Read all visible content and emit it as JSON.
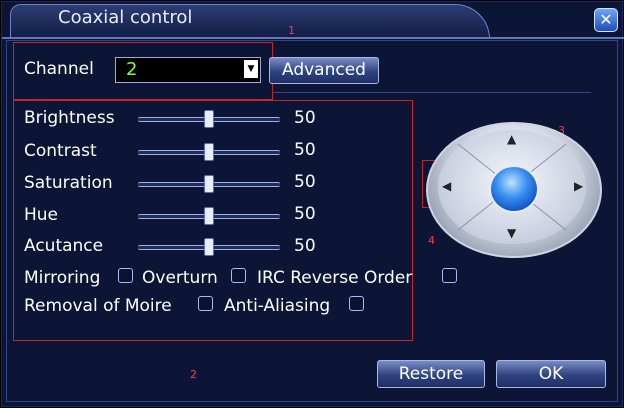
{
  "window": {
    "title": "Coaxial control",
    "close_icon": "close-icon"
  },
  "markers": {
    "m1": "1",
    "m2": "2",
    "m3": "3",
    "m4": "4"
  },
  "channel": {
    "label": "Channel",
    "value": "2",
    "advanced_label": "Advanced"
  },
  "sliders": [
    {
      "label": "Brightness",
      "value": "50",
      "level": 0.5
    },
    {
      "label": "Contrast",
      "value": "50",
      "level": 0.5
    },
    {
      "label": "Saturation",
      "value": "50",
      "level": 0.5
    },
    {
      "label": "Hue",
      "value": "50",
      "level": 0.5
    },
    {
      "label": "Acutance",
      "value": "50",
      "level": 0.5
    }
  ],
  "checkboxes": [
    {
      "label": "Mirroring"
    },
    {
      "label": "Overturn"
    },
    {
      "label": "IRC Reverse Order"
    },
    {
      "label": "Removal of Moire"
    },
    {
      "label": "Anti-Aliasing"
    }
  ],
  "ptz": {
    "up_icon": "arrow-up-icon",
    "down_icon": "arrow-down-icon",
    "left_icon": "arrow-left-icon",
    "right_icon": "arrow-right-icon",
    "center_icon": "center-button"
  },
  "buttons": {
    "restore": "Restore",
    "ok": "OK"
  },
  "colors": {
    "background": "#0c1536",
    "accent": "#93f54a",
    "annotation": "#c2262a"
  }
}
